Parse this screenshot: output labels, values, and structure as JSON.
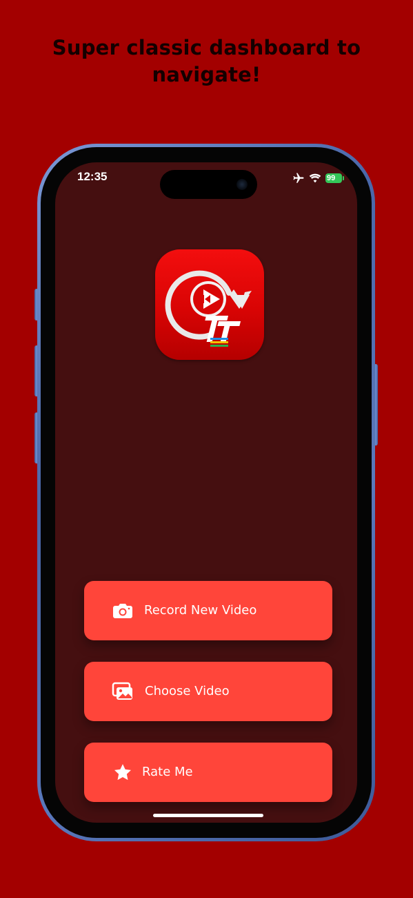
{
  "headline": {
    "line1": "Super classic dashboard to",
    "line2": "navigate!"
  },
  "status_bar": {
    "time": "12:35",
    "battery": "99",
    "icons": [
      "airplane-icon",
      "wifi-icon",
      "battery-charging-icon"
    ]
  },
  "app_icon": {
    "name": "app-logo-icon",
    "colors": {
      "primary": "#e30606",
      "ring": "#ffffff",
      "accent_stripes": [
        "#1f8fe6",
        "#f2c200",
        "#2bb24c"
      ]
    }
  },
  "menu": {
    "buttons": [
      {
        "label": "Record New Video",
        "icon": "camera-icon"
      },
      {
        "label": "Choose Video",
        "icon": "photo-library-icon"
      },
      {
        "label": "Rate Me",
        "icon": "star-icon"
      }
    ]
  },
  "colors": {
    "page_background": "#a30000",
    "screen_background": "#450f10",
    "button_background": "#ff453a",
    "button_text": "#ffffff",
    "phone_frame": "#5a78bb",
    "battery_green": "#34c759"
  }
}
